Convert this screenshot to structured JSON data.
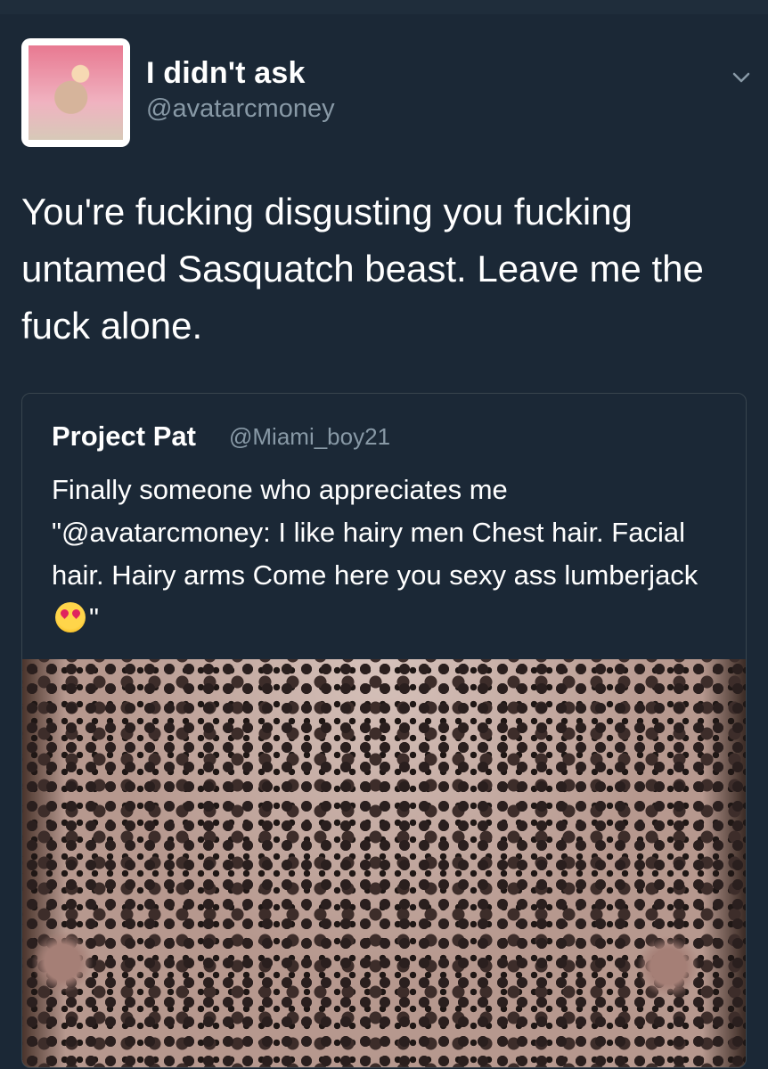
{
  "tweet": {
    "display_name": "I didn't ask",
    "handle": "@avatarcmoney",
    "text": "You're fucking disgusting you fucking untamed Sasquatch beast. Leave me the fuck alone."
  },
  "quoted_tweet": {
    "display_name": "Project Pat",
    "handle": "@Miami_boy21",
    "text_before_emoji": "Finally someone who appreciates me \"@avatarcmoney: I like hairy men Chest hair. Facial hair. Hairy arms Come here you sexy ass lumberjack",
    "text_after_emoji": "\"",
    "emoji": "smiling-face-with-heart-eyes"
  },
  "icons": {
    "menu": "chevron-down-icon"
  },
  "colors": {
    "background": "#1b2836",
    "secondary_text": "#8899a6",
    "border": "#38444d"
  }
}
